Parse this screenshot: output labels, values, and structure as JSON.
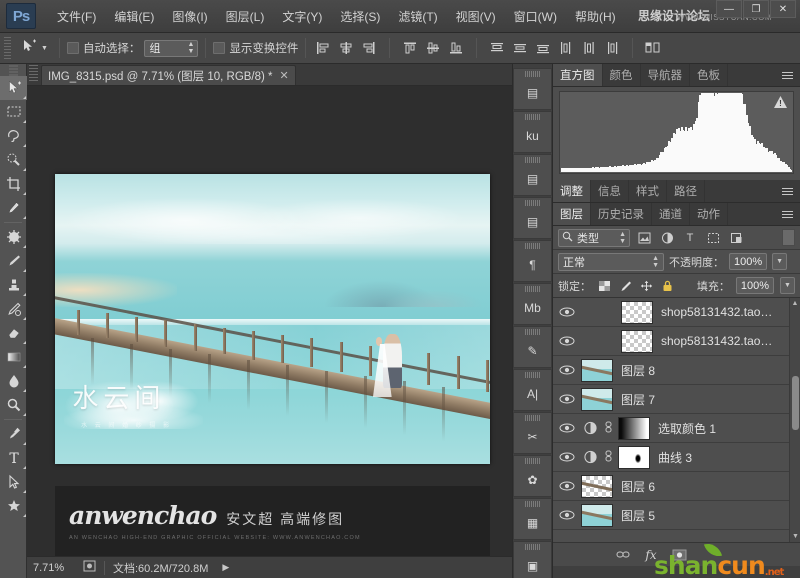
{
  "app": {
    "logo": "Ps",
    "watermark_title": "思缘设计论坛",
    "watermark_url": "WWW.MISSYUAN.COM"
  },
  "menubar": {
    "items": [
      {
        "label": "文件(F)"
      },
      {
        "label": "编辑(E)"
      },
      {
        "label": "图像(I)"
      },
      {
        "label": "图层(L)"
      },
      {
        "label": "文字(Y)"
      },
      {
        "label": "选择(S)"
      },
      {
        "label": "滤镜(T)"
      },
      {
        "label": "视图(V)"
      },
      {
        "label": "窗口(W)"
      },
      {
        "label": "帮助(H)"
      }
    ]
  },
  "window_controls": {
    "minimize": "—",
    "maximize": "❐",
    "close": "✕"
  },
  "options_bar": {
    "auto_select_label": "自动选择：",
    "auto_select_value": "组",
    "show_transform_label": "显示变换控件",
    "icons": [
      "move-tool-icon",
      "align-left-edges-icon",
      "align-horizontal-centers-icon",
      "align-right-edges-icon",
      "align-top-edges-icon",
      "align-vertical-centers-icon",
      "align-bottom-edges-icon",
      "distribute-top-icon",
      "distribute-vertical-center-icon",
      "distribute-bottom-icon",
      "distribute-left-icon",
      "distribute-horizontal-center-icon",
      "distribute-right-icon",
      "3d-mode-icon"
    ]
  },
  "toolbar": {
    "tools": [
      {
        "name": "move-tool",
        "active": true
      },
      {
        "name": "rectangular-marquee-tool",
        "active": false
      },
      {
        "name": "lasso-tool",
        "active": false
      },
      {
        "name": "quick-selection-tool",
        "active": false
      },
      {
        "name": "crop-tool",
        "active": false
      },
      {
        "name": "eyedropper-tool",
        "active": false
      },
      {
        "name": "spot-healing-brush-tool",
        "active": false
      },
      {
        "name": "brush-tool",
        "active": false
      },
      {
        "name": "clone-stamp-tool",
        "active": false
      },
      {
        "name": "history-brush-tool",
        "active": false
      },
      {
        "name": "eraser-tool",
        "active": false
      },
      {
        "name": "gradient-tool",
        "active": false
      },
      {
        "name": "blur-tool",
        "active": false
      },
      {
        "name": "dodge-tool",
        "active": false
      },
      {
        "name": "pen-tool",
        "active": false
      },
      {
        "name": "horizontal-type-tool",
        "active": false
      },
      {
        "name": "path-selection-tool",
        "active": false
      },
      {
        "name": "custom-shape-tool",
        "active": false
      }
    ]
  },
  "document": {
    "tab_title": "IMG_8315.psd @ 7.71% (图层 10, RGB/8) *",
    "close_label": "✕",
    "canvas": {
      "title_cn": "水云间",
      "subtitle_cn": "水 云 间 婚 纱 摄 影",
      "brand_script": "anwenchao",
      "brand_cn": "安文超 高端修图",
      "brand_sub": "AN WENCHAO  HIGH-END GRAPHIC OFFICIAL  WEBSITE: WWW.ANWENCHAO.COM"
    }
  },
  "status_bar": {
    "zoom": "7.71%",
    "doc_info": "文档:60.2M/720.8M",
    "arrow": "▶",
    "preview_icon": "preview-box-icon"
  },
  "dock": {
    "items": [
      {
        "name": "brush-presets-panel-icon",
        "glyph": "▤"
      },
      {
        "name": "kuler-panel-icon",
        "glyph": "ku"
      },
      {
        "name": "notes-panel-icon",
        "glyph": "▤"
      },
      {
        "name": "paragraph-panel-icon",
        "glyph": "▤"
      },
      {
        "name": "paragraph-styles-panel-icon",
        "glyph": "¶"
      },
      {
        "name": "measurement-log-panel-icon",
        "glyph": "Mb"
      },
      {
        "name": "tool-presets-panel-icon",
        "glyph": "✎"
      },
      {
        "name": "character-panel-icon",
        "glyph": "A|"
      },
      {
        "name": "tools-panel-icon",
        "glyph": "✂"
      },
      {
        "name": "brushes-panel-icon",
        "glyph": "✿"
      },
      {
        "name": "timeline-panel-icon",
        "glyph": "▦"
      },
      {
        "name": "layer-comps-panel-icon",
        "glyph": "▣"
      }
    ]
  },
  "panels": {
    "group_top": {
      "tabs": [
        {
          "label": "直方图",
          "active": true
        },
        {
          "label": "颜色",
          "active": false
        },
        {
          "label": "导航器",
          "active": false
        },
        {
          "label": "色板",
          "active": false
        }
      ],
      "menu_icon": "panel-menu-icon",
      "warning_icon": "histogram-cache-warning-icon",
      "warning_glyph": "!"
    },
    "group_adjust": {
      "tabs": [
        {
          "label": "调整",
          "active": true
        },
        {
          "label": "信息",
          "active": false
        },
        {
          "label": "样式",
          "active": false
        },
        {
          "label": "路径",
          "active": false
        }
      ],
      "menu_icon": "panel-menu-icon"
    },
    "group_layers": {
      "tabs": [
        {
          "label": "图层",
          "active": true
        },
        {
          "label": "历史记录",
          "active": false
        },
        {
          "label": "通道",
          "active": false
        },
        {
          "label": "动作",
          "active": false
        }
      ],
      "menu_icon": "panel-menu-icon"
    }
  },
  "layers_panel": {
    "filter": {
      "search_icon": "search-icon",
      "kind_value": "类型",
      "filter_icons": [
        {
          "name": "filter-pixel-layers-icon",
          "glyph": "▣"
        },
        {
          "name": "filter-adjustment-layers-icon",
          "glyph": "◐"
        },
        {
          "name": "filter-type-layers-icon",
          "glyph": "T"
        },
        {
          "name": "filter-shape-layers-icon",
          "glyph": "▢"
        },
        {
          "name": "filter-smart-objects-icon",
          "glyph": "▤"
        }
      ],
      "toggle_name": "filter-enable-toggle"
    },
    "blend_mode": "正常",
    "opacity_label": "不透明度：",
    "opacity_value": "100%",
    "lock_label": "锁定：",
    "lock_icons": [
      {
        "name": "lock-transparent-pixels-icon",
        "glyph": "▦"
      },
      {
        "name": "lock-image-pixels-icon",
        "glyph": "🖌"
      },
      {
        "name": "lock-position-icon",
        "glyph": "✥"
      },
      {
        "name": "lock-all-icon",
        "glyph": "🔒"
      }
    ],
    "fill_label": "填充：",
    "fill_value": "100%",
    "layers": [
      {
        "name": "shop58131432.tao…",
        "thumb": "checker",
        "visible": true,
        "kind": "pixel"
      },
      {
        "name": "shop58131432.tao…",
        "thumb": "checker",
        "visible": true,
        "kind": "pixel"
      },
      {
        "name": "图层 8",
        "thumb": "photo",
        "visible": true,
        "kind": "pixel"
      },
      {
        "name": "图层 7",
        "thumb": "photo",
        "visible": true,
        "kind": "pixel"
      },
      {
        "name": "选取颜色 1",
        "thumb": "mask-grad",
        "visible": true,
        "kind": "adjustment",
        "adj_icon": "selective-color-icon"
      },
      {
        "name": "曲线 3",
        "thumb": "mask-spot",
        "visible": true,
        "kind": "adjustment",
        "adj_icon": "curves-icon"
      },
      {
        "name": "图层 6",
        "thumb": "line",
        "visible": true,
        "kind": "pixel"
      },
      {
        "name": "图层 5",
        "thumb": "photo",
        "visible": true,
        "kind": "pixel"
      }
    ],
    "footer_icons": [
      {
        "name": "link-layers-icon",
        "glyph": "🔗"
      },
      {
        "name": "layer-style-icon",
        "glyph": "fx"
      },
      {
        "name": "add-layer-mask-icon",
        "glyph": "▣"
      }
    ]
  },
  "overlay_watermark": {
    "part1": "shan",
    "part2": "cun",
    "part3": ".net"
  }
}
